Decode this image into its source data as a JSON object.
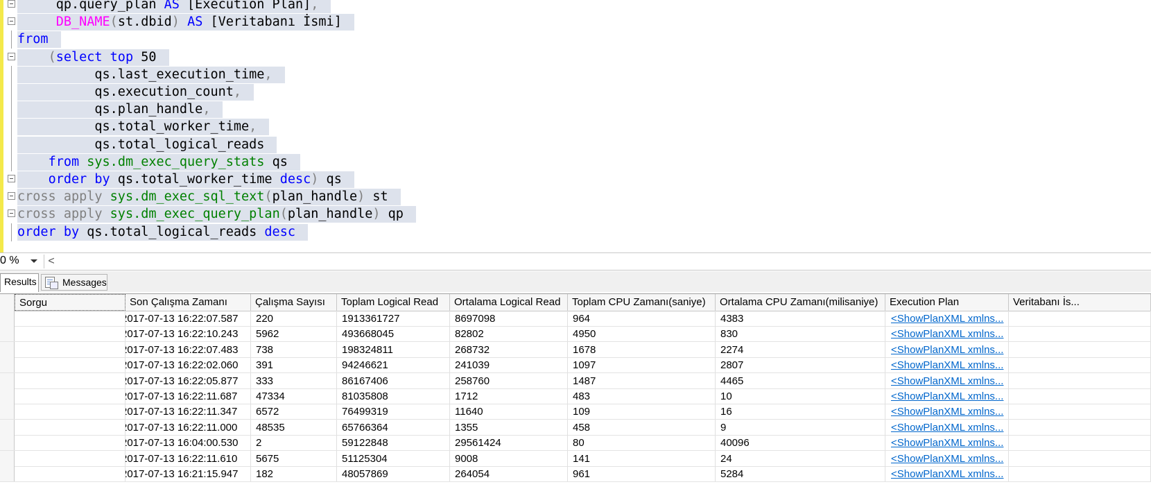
{
  "editor": {
    "lines": [
      [
        [
          "tx",
          "     qp.query_plan "
        ],
        [
          "kw",
          "AS"
        ],
        [
          "tx",
          " [Execution Plan]"
        ],
        [
          "gr",
          ","
        ]
      ],
      [
        [
          "tx",
          "     "
        ],
        [
          "fn",
          "DB_NAME"
        ],
        [
          "gr",
          "("
        ],
        [
          "tx",
          "st.dbid"
        ],
        [
          "gr",
          ")"
        ],
        [
          "tx",
          " "
        ],
        [
          "kw",
          "AS"
        ],
        [
          "tx",
          " [Veritabanı İsmi]"
        ]
      ],
      [
        [
          "kw",
          "from"
        ]
      ],
      [
        [
          "tx",
          "    "
        ],
        [
          "gr",
          "("
        ],
        [
          "kw",
          "select top"
        ],
        [
          "tx",
          " 50"
        ]
      ],
      [
        [
          "tx",
          "          qs.last_execution_time"
        ],
        [
          "gr",
          ","
        ]
      ],
      [
        [
          "tx",
          "          qs.execution_count"
        ],
        [
          "gr",
          ","
        ]
      ],
      [
        [
          "tx",
          "          qs.plan_handle"
        ],
        [
          "gr",
          ","
        ]
      ],
      [
        [
          "tx",
          "          qs.total_worker_time"
        ],
        [
          "gr",
          ","
        ]
      ],
      [
        [
          "tx",
          "          qs.total_logical_reads"
        ]
      ],
      [
        [
          "tx",
          "    "
        ],
        [
          "kw",
          "from"
        ],
        [
          "tx",
          " "
        ],
        [
          "sys",
          "sys.dm_exec_query_stats"
        ],
        [
          "tx",
          " qs"
        ]
      ],
      [
        [
          "tx",
          "    "
        ],
        [
          "kw",
          "order by"
        ],
        [
          "tx",
          " qs.total_worker_time "
        ],
        [
          "kw",
          "desc"
        ],
        [
          "gr",
          ")"
        ],
        [
          "tx",
          " qs"
        ]
      ],
      [
        [
          "gr",
          "cross apply"
        ],
        [
          "tx",
          " "
        ],
        [
          "sys",
          "sys.dm_exec_sql_text"
        ],
        [
          "gr",
          "("
        ],
        [
          "tx",
          "plan_handle"
        ],
        [
          "gr",
          ")"
        ],
        [
          "tx",
          " st"
        ]
      ],
      [
        [
          "gr",
          "cross apply"
        ],
        [
          "tx",
          " "
        ],
        [
          "sys",
          "sys.dm_exec_query_plan"
        ],
        [
          "gr",
          "("
        ],
        [
          "tx",
          "plan_handle"
        ],
        [
          "gr",
          ")"
        ],
        [
          "tx",
          " qp"
        ]
      ],
      [
        [
          "kw",
          "order by"
        ],
        [
          "tx",
          " qs.total_logical_reads "
        ],
        [
          "kw",
          "desc"
        ]
      ]
    ]
  },
  "zoom": {
    "value": "0 %",
    "scroll_left": "<"
  },
  "tabs": {
    "results": "Results",
    "messages": "Messages"
  },
  "grid": {
    "columns": [
      "Sorgu",
      "Son Çalışma Zamanı",
      "Çalışma Sayısı",
      "Toplam Logical Read",
      "Ortalama Logical Read",
      "Toplam CPU Zamanı(saniye)",
      "Ortalama CPU Zamanı(milisaniye)",
      "Execution Plan",
      "Veritabanı İs..."
    ],
    "rows": [
      [
        "",
        "2017-07-13 16:22:07.587",
        "220",
        "1913361727",
        "8697098",
        "964",
        "4383",
        "<ShowPlanXML xmlns...",
        ""
      ],
      [
        "",
        "2017-07-13 16:22:10.243",
        "5962",
        "493668045",
        "82802",
        "4950",
        "830",
        "<ShowPlanXML xmlns...",
        ""
      ],
      [
        "",
        "2017-07-13 16:22:07.483",
        "738",
        "198324811",
        "268732",
        "1678",
        "2274",
        "<ShowPlanXML xmlns...",
        ""
      ],
      [
        "",
        "2017-07-13 16:22:02.060",
        "391",
        "94246621",
        "241039",
        "1097",
        "2807",
        "<ShowPlanXML xmlns...",
        ""
      ],
      [
        "",
        "2017-07-13 16:22:05.877",
        "333",
        "86167406",
        "258760",
        "1487",
        "4465",
        "<ShowPlanXML xmlns...",
        ""
      ],
      [
        "",
        "2017-07-13 16:22:11.687",
        "47334",
        "81035808",
        "1712",
        "483",
        "10",
        "<ShowPlanXML xmlns...",
        ""
      ],
      [
        "",
        "2017-07-13 16:22:11.347",
        "6572",
        "76499319",
        "11640",
        "109",
        "16",
        "<ShowPlanXML xmlns...",
        ""
      ],
      [
        "",
        "2017-07-13 16:22:11.000",
        "48535",
        "65766364",
        "1355",
        "458",
        "9",
        "<ShowPlanXML xmlns...",
        ""
      ],
      [
        "",
        "2017-07-13 16:04:00.530",
        "2",
        "59122848",
        "29561424",
        "80",
        "40096",
        "<ShowPlanXML xmlns...",
        ""
      ],
      [
        "",
        "2017-07-13 16:22:11.610",
        "5675",
        "51125304",
        "9008",
        "141",
        "24",
        "<ShowPlanXML xmlns...",
        ""
      ],
      [
        "",
        "2017-07-13 16:21:15.947",
        "182",
        "48057869",
        "264054",
        "961",
        "5284",
        "<ShowPlanXML xmlns...",
        ""
      ]
    ]
  }
}
